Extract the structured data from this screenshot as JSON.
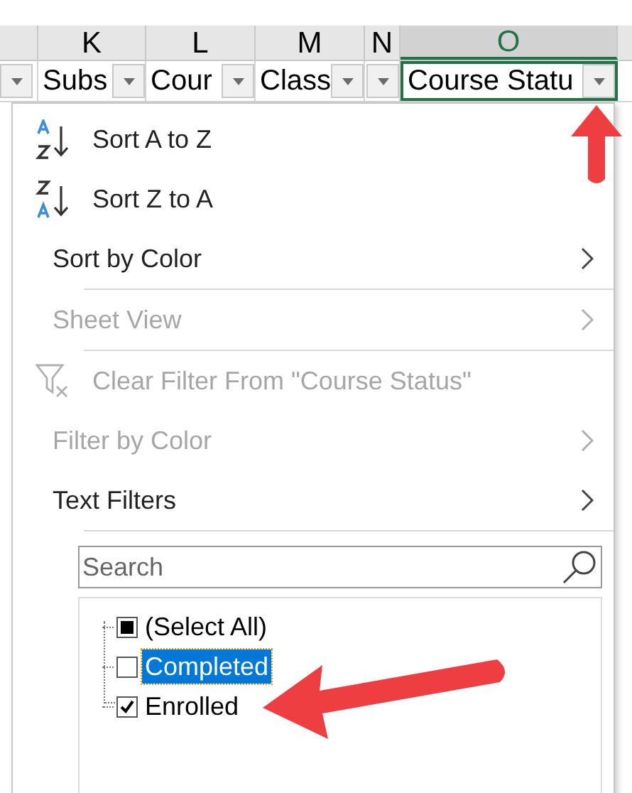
{
  "column_headers": [
    {
      "selected": false
    },
    {
      "label": "K",
      "selected": false
    },
    {
      "label": "L",
      "selected": false
    },
    {
      "label": "M",
      "selected": false
    },
    {
      "label": "N",
      "selected": false
    },
    {
      "label": "O",
      "selected": true
    }
  ],
  "header_cells": [
    {
      "selected": false
    },
    {
      "label": "Subs",
      "selected": false
    },
    {
      "label": "Cour",
      "selected": false
    },
    {
      "label": "Class",
      "selected": false
    },
    {
      "selected": false
    },
    {
      "label": "Course Statu",
      "selected": true
    }
  ],
  "menu": [
    {
      "kind": "sort-asc",
      "label": "Sort A to Z",
      "disabled": false,
      "separator_after": false
    },
    {
      "kind": "sort-desc",
      "label": "Sort Z to A",
      "disabled": false,
      "separator_after": false
    },
    {
      "kind": "submenu",
      "label": "Sort by Color",
      "disabled": false,
      "separator_after": true
    },
    {
      "kind": "submenu",
      "label": "Sheet View",
      "disabled": true,
      "separator_after": true
    },
    {
      "kind": "clear",
      "label": "Clear Filter From \"Course Status\"",
      "disabled": true,
      "separator_after": false
    },
    {
      "kind": "submenu",
      "label": "Filter by Color",
      "disabled": true,
      "separator_after": false
    },
    {
      "kind": "submenu",
      "label": "Text Filters",
      "disabled": false,
      "separator_after": true
    }
  ],
  "search": {
    "placeholder": "Search"
  },
  "values": [
    {
      "label": "(Select All)",
      "checked": false,
      "mixed": true,
      "selected": false
    },
    {
      "label": "Completed",
      "checked": false,
      "mixed": false,
      "selected": true
    },
    {
      "label": "Enrolled",
      "checked": true,
      "mixed": false,
      "selected": false
    }
  ]
}
